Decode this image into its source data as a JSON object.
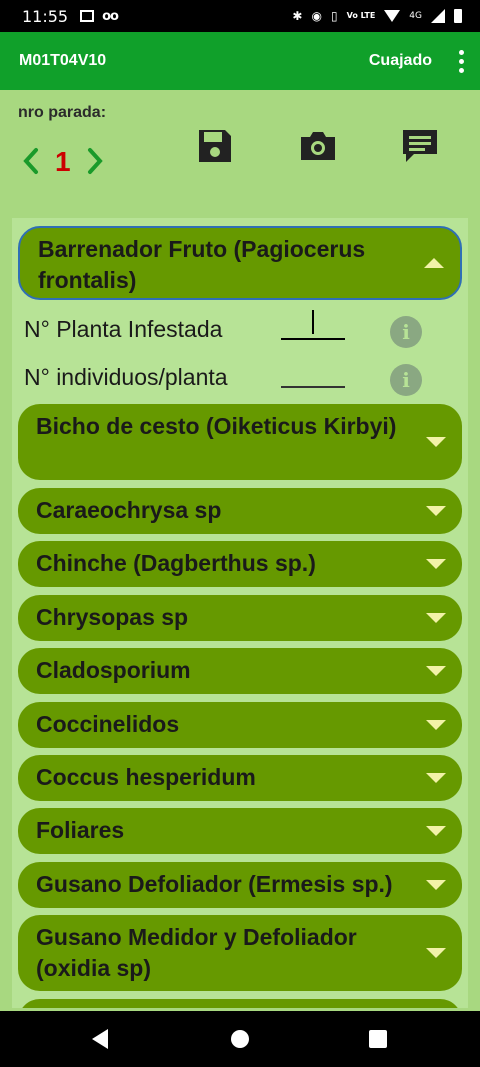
{
  "status_bar": {
    "time": "11:55",
    "volte": "Vo LTE",
    "network": "4G"
  },
  "app_bar": {
    "title": "M01T04V10",
    "stage": "Cuajado"
  },
  "toolbar": {
    "nro_label": "nro parada:",
    "stop_number": "1",
    "icons": [
      "save-icon",
      "camera-icon",
      "comment-icon"
    ]
  },
  "accordion": {
    "expanded": {
      "label": "Barrenador Fruto (Pagiocerus frontalis)",
      "fields": [
        {
          "label": "N° Planta Infestada",
          "value": ""
        },
        {
          "label": "N° individuos/planta",
          "value": ""
        }
      ]
    },
    "items": [
      "Bicho de cesto  (Oiketicus Kirbyi)",
      "Caraeochrysa sp",
      "Chinche  (Dagberthus sp.)",
      "Chrysopas sp",
      "Cladosporium",
      "Coccinelidos",
      "Coccus hesperidum",
      "Foliares",
      "Gusano Defoliador (Ermesis sp.)",
      "Gusano Medidor y Defoliador (oxidia sp)"
    ]
  },
  "colors": {
    "app_bar": "#10a02a",
    "toolbar_bg": "#a8d880",
    "item_bg": "#669900",
    "stop_number": "#cc0000",
    "chevron": "#f2f2a8"
  }
}
